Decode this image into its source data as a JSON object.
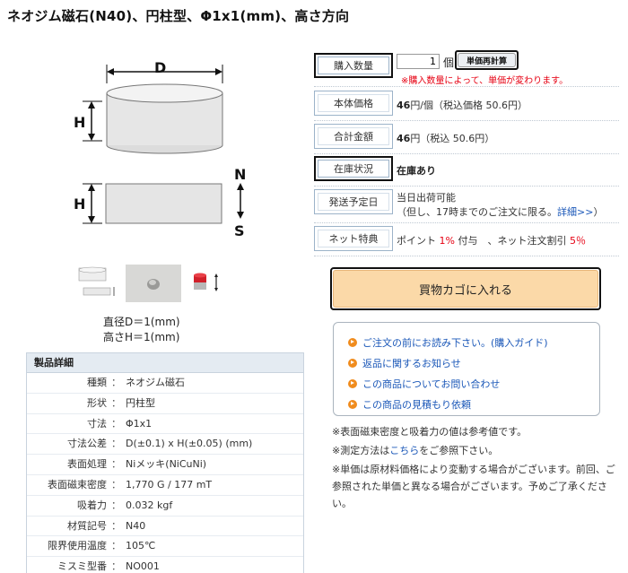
{
  "title": "ネオジム磁石(N40)、円柱型、Φ1x1(mm)、高さ方向",
  "diagram": {
    "d_label": "D",
    "h_label": "H",
    "h_label2": "H",
    "n_label": "N",
    "s_label": "S"
  },
  "thumb_labels": {
    "magnet_mark": ""
  },
  "dimensions": {
    "line1": "直径D＝1(mm)",
    "line2": "高さH＝1(mm)"
  },
  "spec": {
    "heading": "製品詳細",
    "colon": "：",
    "rows": [
      {
        "label": "種類",
        "value": "ネオジム磁石"
      },
      {
        "label": "形状",
        "value": "円柱型"
      },
      {
        "label": "寸法",
        "value": "Φ1x1"
      },
      {
        "label": "寸法公差",
        "value": "D(±0.1) x H(±0.05) (mm)"
      },
      {
        "label": "表面処理",
        "value": "Niメッキ(NiCuNi)"
      },
      {
        "label": "表面磁束密度",
        "value": "1,770 G / 177 mT"
      },
      {
        "label": "吸着力",
        "value": "0.032 kgf"
      },
      {
        "label": "材質記号",
        "value": "N40"
      },
      {
        "label": "限界使用温度",
        "value": "105℃"
      },
      {
        "label": "ミスミ型番",
        "value": "NO001"
      }
    ]
  },
  "purchase": {
    "qty_label": "購入数量",
    "qty_value": "1",
    "qty_unit": "個",
    "recalc_button": "単価再計算",
    "qty_note": "※購入数量によって、単価が変わります。",
    "unit_price_label": "本体価格",
    "unit_price_amount": "46",
    "unit_price_suffix": "円/個（税込価格 50.6円）",
    "total_label": "合計金額",
    "total_amount": "46",
    "total_suffix": "円（税込 50.6円）",
    "stock_label": "在庫状況",
    "stock_value": "在庫あり",
    "ship_label": "発送予定日",
    "ship_line1": "当日出荷可能",
    "ship_line2": "（但し、17時までのご注文に限る。",
    "ship_link": "詳細>>",
    "ship_line2_end": "）",
    "net_label": "ネット特典",
    "net_text1": "ポイント ",
    "net_pct1": "1%",
    "net_text2": " 付与　、ネット注文割引 ",
    "net_pct2": "5％",
    "cart_button": "買物カゴに入れる"
  },
  "links": [
    "ご注文の前にお読み下さい。(購入ガイド)",
    "返品に関するお知らせ",
    "この商品についてお問い合わせ",
    "この商品の見積もり依頼"
  ],
  "notes": {
    "note1": "※表面磁束密度と吸着力の値は参考値です。",
    "note2_a": "※測定方法は",
    "note2_link": "こちら",
    "note2_b": "をご参照下さい。",
    "note3": "※単価は原材料価格により変動する場合がございます。前回、ご参照された単価と異なる場合がございます。予めご了承ください。"
  },
  "colors": {
    "accent_red": "#e60012",
    "link_blue": "#1a57b8",
    "cart_bg": "#fbd9a8",
    "bullet_orange": "#f08c1e"
  }
}
